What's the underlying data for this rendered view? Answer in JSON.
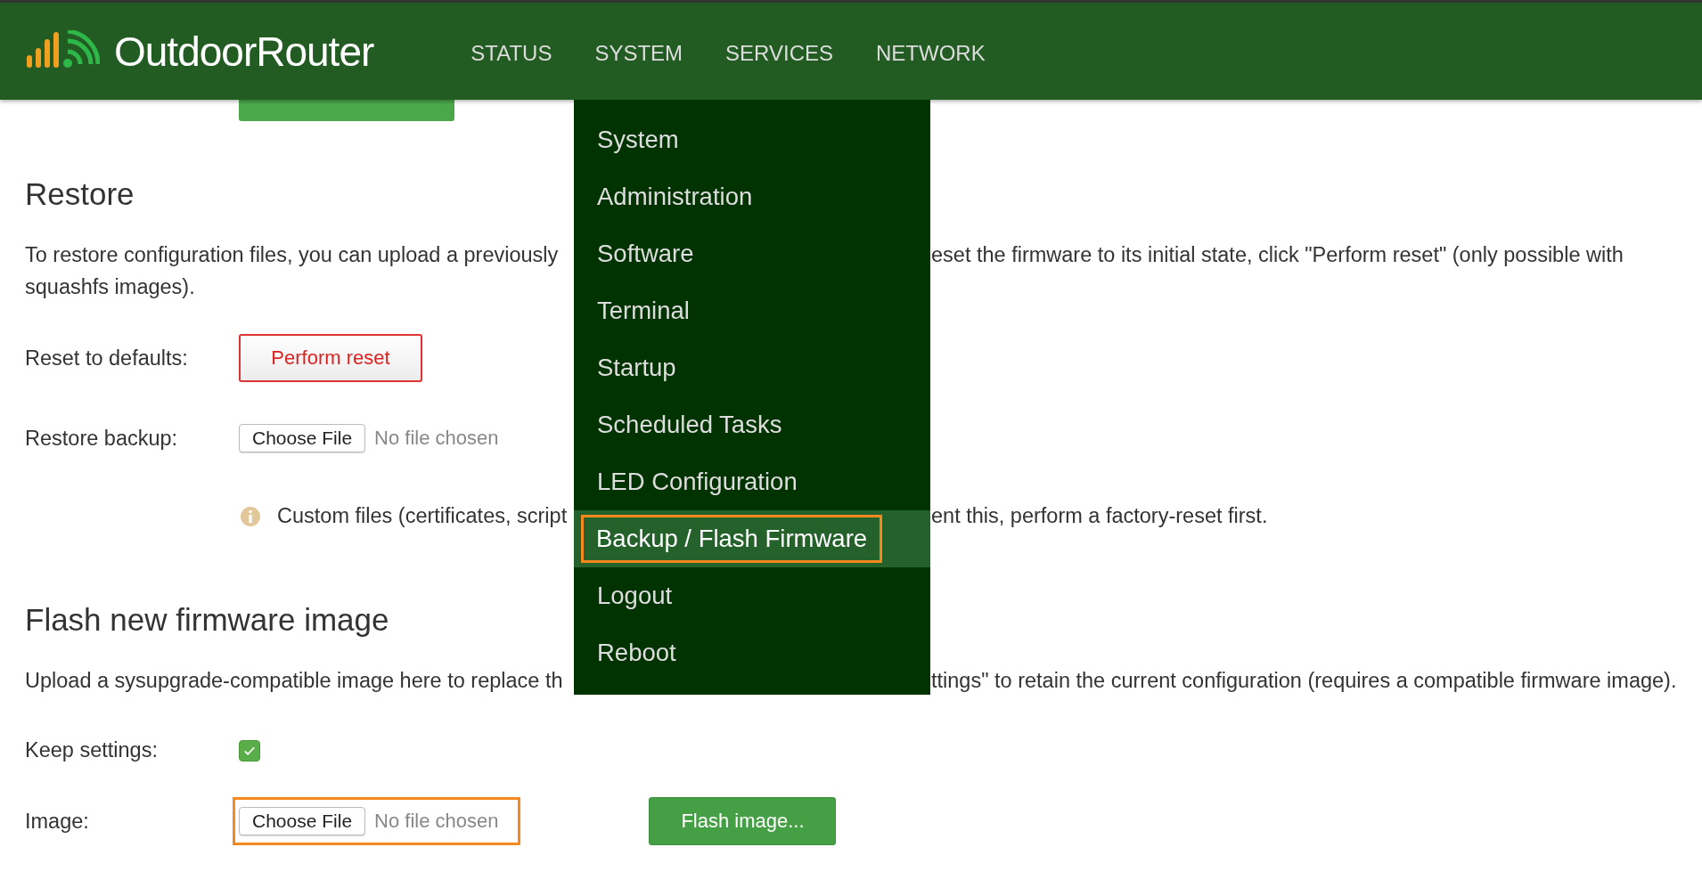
{
  "header": {
    "brand": "OutdoorRouter",
    "nav": [
      {
        "label": "STATUS"
      },
      {
        "label": "SYSTEM"
      },
      {
        "label": "SERVICES"
      },
      {
        "label": "NETWORK"
      }
    ]
  },
  "menu": {
    "items": [
      {
        "label": "System",
        "selected": false
      },
      {
        "label": "Administration",
        "selected": false
      },
      {
        "label": "Software",
        "selected": false
      },
      {
        "label": "Terminal",
        "selected": false
      },
      {
        "label": "Startup",
        "selected": false
      },
      {
        "label": "Scheduled Tasks",
        "selected": false
      },
      {
        "label": "LED Configuration",
        "selected": false
      },
      {
        "label": "Backup / Flash Firmware",
        "selected": true
      },
      {
        "label": "Logout",
        "selected": false
      },
      {
        "label": "Reboot",
        "selected": false
      }
    ]
  },
  "restore": {
    "title": "Restore",
    "description_left": "To restore configuration files, you can upload a previously",
    "description_right": "eset the firmware to its initial state, click \"Perform reset\" (only possible with",
    "description_wrap": "squashfs images).",
    "reset_label": "Reset to defaults:",
    "reset_button": "Perform reset",
    "backup_label": "Restore backup:",
    "backup_file": {
      "button": "Choose File",
      "status": "No file chosen",
      "highlighted": false
    },
    "note_left": "Custom files (certificates, script",
    "note_right": "ent this, perform a factory-reset first."
  },
  "flash": {
    "title": "Flash new firmware image",
    "description_left": "Upload a sysupgrade-compatible image here to replace th",
    "description_right": "ttings\" to retain the current configuration (requires a compatible firmware image).",
    "keep_label": "Keep settings:",
    "keep_checked": true,
    "image_label": "Image:",
    "image_file": {
      "button": "Choose File",
      "status": "No file chosen",
      "highlighted": true
    },
    "flash_button": "Flash image..."
  }
}
